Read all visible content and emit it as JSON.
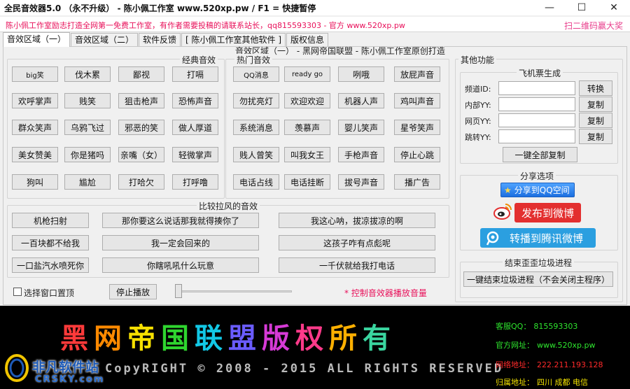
{
  "window": {
    "title": "全民音效器5.0 （永不升级） - 陈小佩工作室 www.520xp.pw / F1 = 快捷暂停",
    "min": "—",
    "max": "☐",
    "close": "✕"
  },
  "notice": {
    "left": "陈小佩工作室励志打造全网第一免费工作室，有作者需要投稿的请联系站长，qq815593303 - 官方 www.520xp.pw",
    "right": "扫二维码赢大奖"
  },
  "tabs": [
    "音效区域（一）",
    "音效区域（二）",
    "软件反馈",
    "[ 陈小佩工作室其他软件 ]",
    "版权信息"
  ],
  "panel_caption": "音效区域（一） - 黑网帝国联盟 - 陈小佩工作室原创打造",
  "classic": {
    "title": "经典音效",
    "buttons": [
      "big笑",
      "伐木累",
      "鄙视",
      "打嗝",
      "欢呼掌声",
      "贱笑",
      "狙击枪声",
      "恐怖声音",
      "群众笑声",
      "乌鸦飞过",
      "邪恶的笑",
      "做人厚道",
      "美女赞美",
      "你是猪吗",
      "亲嘴（女）",
      "轻微掌声",
      "狗叫",
      "尴尬",
      "打哈欠",
      "打呼噜"
    ]
  },
  "hot": {
    "title": "热门音效",
    "buttons": [
      "QQ消息",
      "ready go",
      "咧哦",
      "放屁声音",
      "勿扰亮灯",
      "欢迎欢迎",
      "机器人声",
      "鸡叫声音",
      "系统消息",
      "羡慕声",
      "婴儿笑声",
      "星爷笑声",
      "贱人曾笑",
      "叫我女王",
      "手枪声音",
      "停止心跳",
      "电话占线",
      "电话挂断",
      "拔号声音",
      "播广告"
    ]
  },
  "flirt": {
    "title": "比较拉风的音效",
    "rows": [
      [
        "机枪扫射",
        "那你要这么说话那我就得揍你了",
        "我这心呐，拔凉拔凉的啊"
      ],
      [
        "一百块都不给我",
        "我一定会回来的",
        "这孩子咋有点彪呢"
      ],
      [
        "一口盐汽水喷死你",
        "你瞎吼吼什么玩意",
        "一千伏就给我打电话"
      ]
    ]
  },
  "bottom": {
    "topmost_label": "选择窗口置顶",
    "stop_label": "停止播放",
    "hint": "* 控制音效器播放音量",
    "volume": 0.0
  },
  "other": {
    "title": "其他功能",
    "ticket": {
      "title": "飞机票生成",
      "fields": [
        {
          "label": "频道ID:",
          "value": "",
          "button": "转换"
        },
        {
          "label": "内部YY:",
          "value": "",
          "button": "复制"
        },
        {
          "label": "网页YY:",
          "value": "",
          "button": "复制"
        },
        {
          "label": "跳转YY:",
          "value": "",
          "button": "复制"
        }
      ],
      "copy_all": "一键全部复制"
    },
    "share": {
      "title": "分享选项",
      "qq": "分享到QQ空间",
      "weibo": "发布到微博",
      "tweibo": "转播到腾讯微博"
    },
    "kill": {
      "title": "结束歪歪垃圾进程",
      "button": "一键结束垃圾进程（不会关闭主程序）"
    }
  },
  "banner": {
    "title_chars": [
      "黑",
      "网",
      "帝",
      "国",
      "联",
      "盟",
      "版",
      "权",
      "所",
      "有"
    ],
    "title_colors": [
      "#ff3a3a",
      "#ff8a00",
      "#f6e000",
      "#2fd62f",
      "#12c8e6",
      "#6a5cff",
      "#d63ad6",
      "#ff3a8a",
      "#ffb000",
      "#3ad6a0"
    ],
    "copyright": "CopyRIGHT © 2008 - 2015 ALL RIGHTS RESERVED",
    "info": [
      {
        "label": "客服QQ：",
        "value": "815593303",
        "color": "#2ee62e"
      },
      {
        "label": "官方网址：",
        "value": "www.520xp.pw",
        "color": "#2ee62e"
      },
      {
        "label": "网络地址：",
        "value": "222.211.193.128",
        "color": "#ff2a2a"
      },
      {
        "label": "归属地址：",
        "value": "四川 成都 电信",
        "color": "#f2e200"
      }
    ]
  },
  "watermark": {
    "name": "非凡软件站",
    "sub": "CRSKY.com"
  }
}
